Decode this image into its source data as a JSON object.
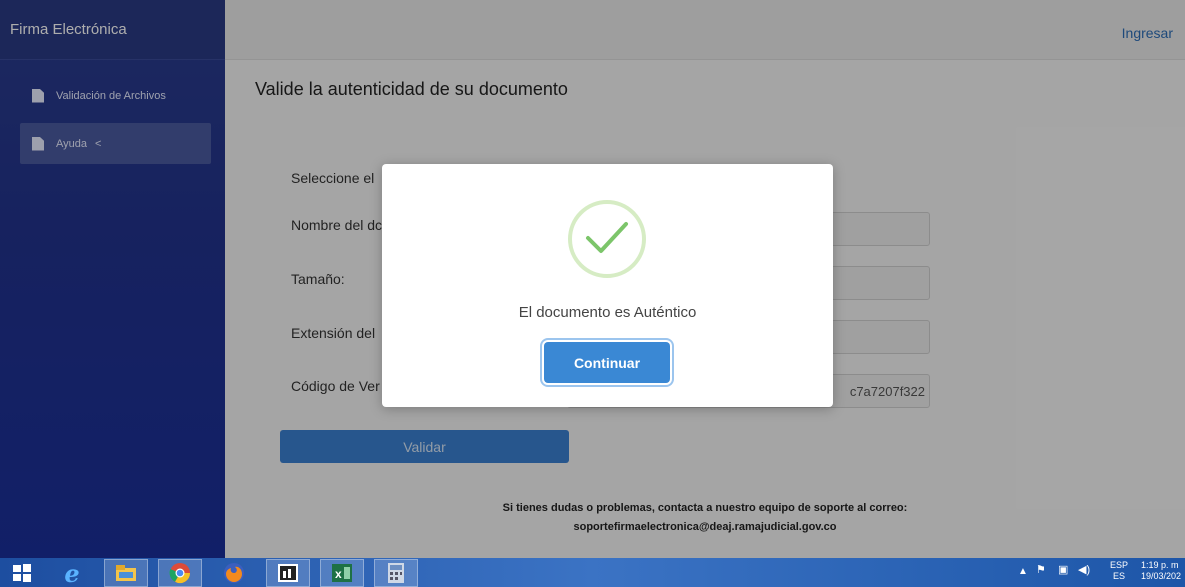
{
  "sidebar": {
    "title": "Firma Electrónica",
    "items": [
      {
        "label": "Validación de Archivos"
      },
      {
        "label": "Ayuda",
        "chevron": "<"
      }
    ]
  },
  "topbar": {
    "login": "Ingresar"
  },
  "main": {
    "title": "Valide la autenticidad de su documento",
    "labels": {
      "select": "Seleccione el",
      "name": "Nombre del dc",
      "size": "Tamaño:",
      "extension": "Extensión del",
      "code": "Código de Ver"
    },
    "fields": {
      "code_value": "c7a7207f322"
    },
    "validate_button": "Validar",
    "support": {
      "line1": "Si tienes dudas o problemas, contacta a nuestro equipo de soporte al correo:",
      "line2": "soportefirmaelectronica@deaj.ramajudicial.gov.co"
    }
  },
  "modal": {
    "message": "El documento es Auténtico",
    "button": "Continuar",
    "icon": "check-icon",
    "accent": "#3a88d4",
    "check_color": "#7cc56a"
  },
  "taskbar": {
    "icons": [
      "windows-start-icon",
      "internet-explorer-icon",
      "file-explorer-icon",
      "chrome-icon",
      "firefox-icon",
      "app-icon",
      "excel-icon",
      "calculator-icon"
    ],
    "tray": {
      "lang_top": "ESP",
      "lang_bottom": "ES",
      "time": "1:19 p. m",
      "date": "19/03/202"
    }
  }
}
